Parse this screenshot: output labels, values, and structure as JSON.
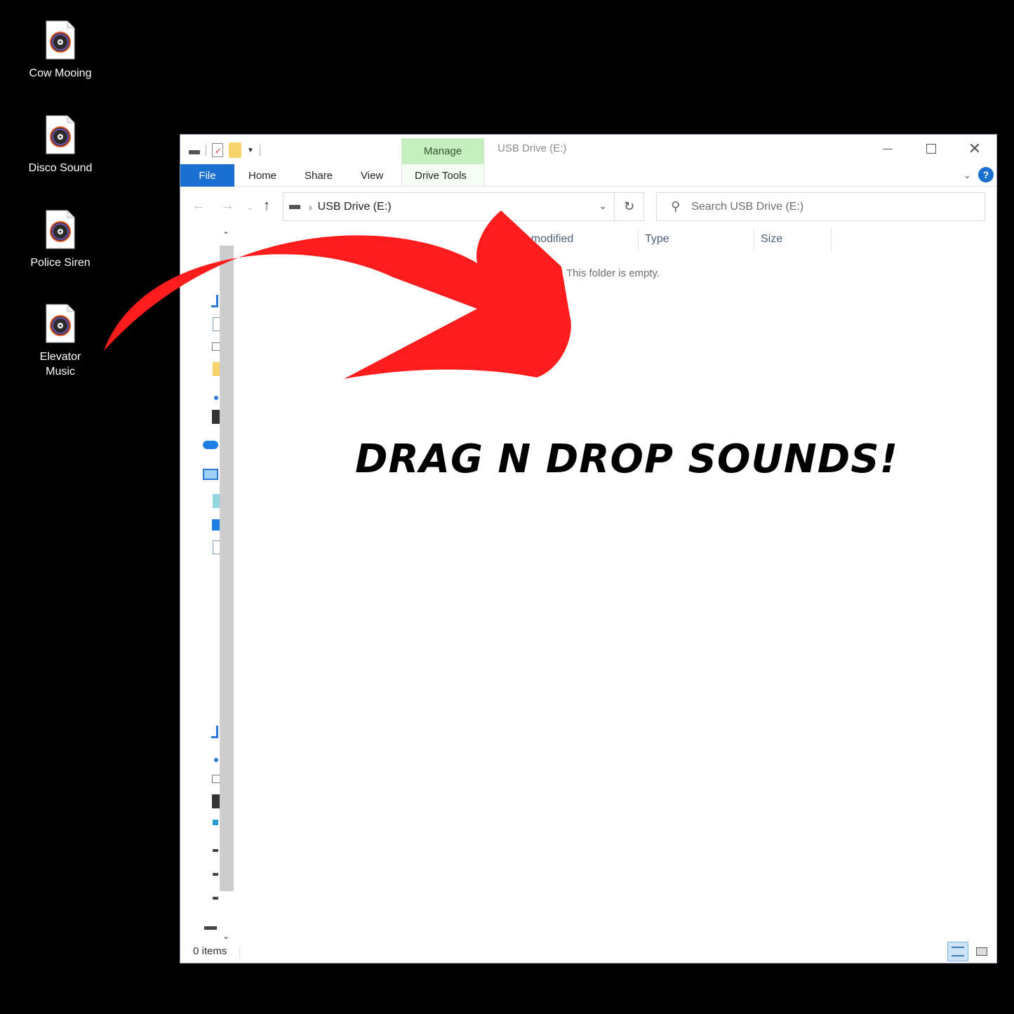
{
  "desktop": {
    "icons": [
      {
        "label": "Cow Mooing"
      },
      {
        "label": "Disco Sound"
      },
      {
        "label": "Police Siren"
      },
      {
        "label": "Elevator Music"
      }
    ]
  },
  "window": {
    "title": "USB Drive (E:)",
    "contextual_tab": "Manage",
    "ribbon_tabs": [
      "File",
      "Home",
      "Share",
      "View",
      "Drive Tools"
    ],
    "address": "USB Drive (E:)",
    "search_placeholder": "Search USB Drive (E:)",
    "columns": [
      "te modified",
      "Type",
      "Size"
    ],
    "empty_message": "This folder is empty.",
    "status": "0 items"
  },
  "overlay": {
    "caption": "DRAG N DROP SOUNDS!",
    "arrow_color": "#ff1c1c"
  },
  "colors": {
    "accent": "#1a6fd0",
    "manage_tab": "#c7eec0",
    "desktop_bg": "#000000"
  }
}
